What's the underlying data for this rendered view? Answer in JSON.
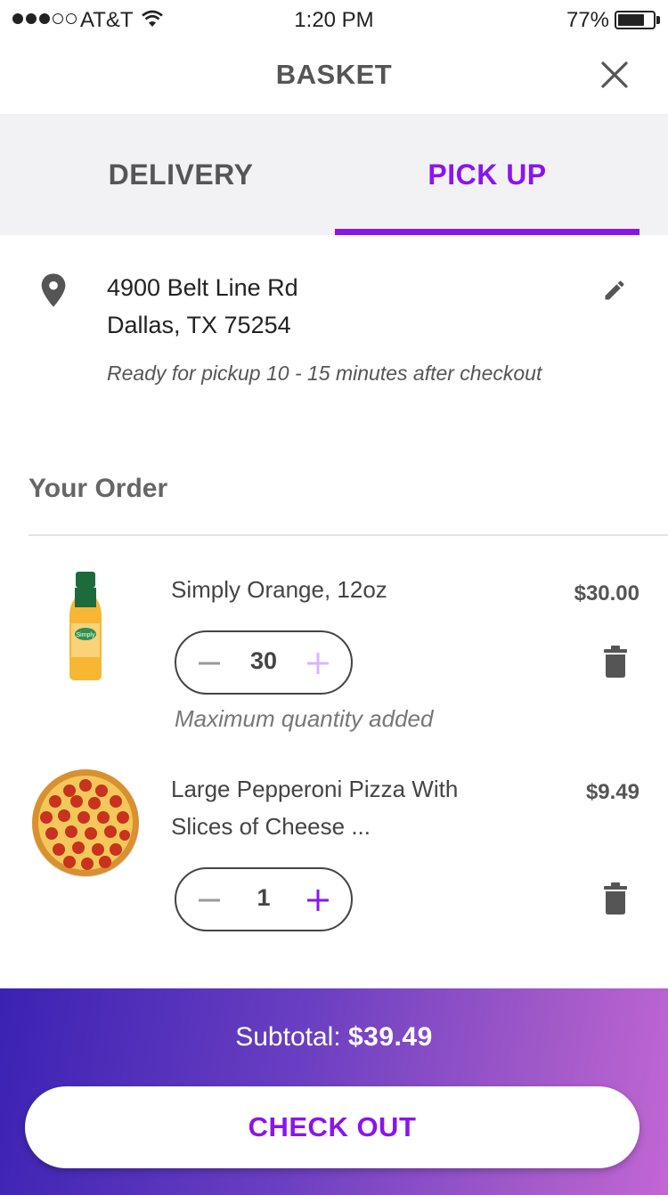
{
  "status_bar": {
    "carrier": "AT&T",
    "time": "1:20 PM",
    "battery_percent": "77%",
    "battery_level": 0.77,
    "signal_bars_filled": 3,
    "signal_bars_total": 5
  },
  "header": {
    "title": "BASKET",
    "close_icon": "close-icon"
  },
  "tabs": {
    "delivery_label": "DELIVERY",
    "pickup_label": "PICK UP",
    "active": "pickup",
    "accent_color": "#8a14f0"
  },
  "location": {
    "line1": "4900 Belt Line Rd",
    "line2": "Dallas, TX 75254",
    "note": "Ready for pickup 10 - 15 minutes after checkout"
  },
  "order": {
    "title": "Your Order",
    "items": [
      {
        "name": "Simply Orange, 12oz",
        "price": "$30.00",
        "quantity": "30",
        "note": "Maximum quantity added",
        "plus_enabled": false,
        "image_icon": "orange-juice-bottle-icon"
      },
      {
        "name": "Large Pepperoni Pizza With Slices of Cheese ...",
        "price": "$9.49",
        "quantity": "1",
        "plus_enabled": true,
        "image_icon": "pepperoni-pizza-icon"
      }
    ]
  },
  "footer": {
    "subtotal_label": "Subtotal:",
    "subtotal_value": "$39.49",
    "checkout_label": "CHECK OUT"
  }
}
